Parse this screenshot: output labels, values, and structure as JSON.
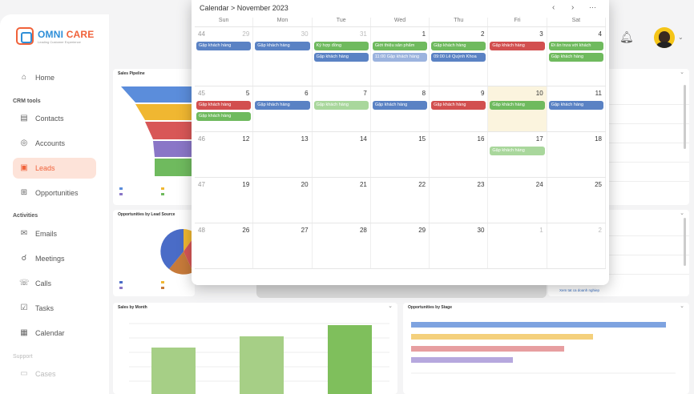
{
  "brand": {
    "name_a": "OMNI",
    "name_b": "CARE",
    "tagline": "Leading Customer Experience"
  },
  "sidebar": {
    "home": "Home",
    "crm_tools_label": "CRM tools",
    "contacts": "Contacts",
    "accounts": "Accounts",
    "leads": "Leads",
    "opportunities": "Opportunities",
    "activities_label": "Activities",
    "emails": "Emails",
    "meetings": "Meetings",
    "calls": "Calls",
    "tasks": "Tasks",
    "calendar": "Calendar",
    "support_label": "Support",
    "cases": "Cases"
  },
  "cards": {
    "sales_pipeline": "Sales Pipeline",
    "opp_by_source": "Opportunities by Lead Source",
    "sales_by_month": "Sales by Month",
    "opp_by_stage": "Opportunities by Stage",
    "view_all_link": "Xem tat ca doanh nghiep"
  },
  "calendar": {
    "breadcrumb": "Calendar > November 2023",
    "days": [
      "Sun",
      "Mon",
      "Tue",
      "Wed",
      "Thu",
      "Fri",
      "Sat"
    ],
    "weeks": [
      {
        "wk": "44",
        "dates": [
          "29",
          "30",
          "31",
          "1",
          "2",
          "3",
          "4"
        ],
        "muted": [
          true,
          true,
          true,
          false,
          false,
          false,
          false
        ],
        "events": [
          {
            "day": 0,
            "row": 0,
            "text": "Gặp khách hàng",
            "color": "blue"
          },
          {
            "day": 1,
            "row": 0,
            "text": "Gặp khách hàng",
            "color": "blue"
          },
          {
            "day": 2,
            "row": 0,
            "text": "Ký hợp đồng",
            "color": "green"
          },
          {
            "day": 2,
            "row": 1,
            "text": "Gặp khách hàng",
            "color": "blue"
          },
          {
            "day": 3,
            "row": 0,
            "text": "Giới thiệu sản phẩm",
            "color": "green"
          },
          {
            "day": 3,
            "row": 1,
            "text": "11:00 Gặp khách hàng",
            "color": "lblue"
          },
          {
            "day": 4,
            "row": 0,
            "text": "Gặp khách hàng",
            "color": "green"
          },
          {
            "day": 4,
            "row": 1,
            "text": "09:00 Lê Quỳnh Khoa",
            "color": "blue"
          },
          {
            "day": 5,
            "row": 0,
            "text": "Gặp khách hàng",
            "color": "red"
          },
          {
            "day": 6,
            "row": 0,
            "text": "Đi ăn trưa với khách",
            "color": "green"
          },
          {
            "day": 6,
            "row": 1,
            "text": "Gặp khách hàng",
            "color": "green"
          }
        ]
      },
      {
        "wk": "45",
        "dates": [
          "5",
          "6",
          "7",
          "8",
          "9",
          "10",
          "11"
        ],
        "muted": [
          false,
          false,
          false,
          false,
          false,
          false,
          false
        ],
        "events": [
          {
            "day": 0,
            "row": 0,
            "text": "Gặp khách hàng",
            "color": "red"
          },
          {
            "day": 0,
            "row": 1,
            "text": "Gặp khách hàng",
            "color": "green"
          },
          {
            "day": 1,
            "row": 0,
            "text": "Gặp khách hàng",
            "color": "blue"
          },
          {
            "day": 2,
            "row": 0,
            "text": "Gặp khách hàng",
            "color": "lgreen"
          },
          {
            "day": 3,
            "row": 0,
            "text": "Gặp khách hàng",
            "color": "blue"
          },
          {
            "day": 4,
            "row": 0,
            "text": "Gặp khách hàng",
            "color": "red"
          },
          {
            "day": 5,
            "row": 0,
            "text": "Gặp khách hàng",
            "color": "green"
          },
          {
            "day": 6,
            "row": 0,
            "text": "Gặp khách hàng",
            "color": "blue"
          }
        ]
      },
      {
        "wk": "46",
        "dates": [
          "12",
          "13",
          "14",
          "15",
          "16",
          "17",
          "18"
        ],
        "muted": [
          false,
          false,
          false,
          false,
          false,
          false,
          false
        ],
        "events": [
          {
            "day": 5,
            "row": 0,
            "text": "Gặp khách hàng",
            "color": "lgreen"
          }
        ]
      },
      {
        "wk": "47",
        "dates": [
          "19",
          "20",
          "21",
          "22",
          "23",
          "24",
          "25"
        ],
        "muted": [
          false,
          false,
          false,
          false,
          false,
          false,
          false
        ],
        "events": []
      },
      {
        "wk": "48",
        "dates": [
          "26",
          "27",
          "28",
          "29",
          "30",
          "1",
          "2"
        ],
        "muted": [
          false,
          false,
          false,
          false,
          false,
          true,
          true
        ],
        "events": []
      }
    ],
    "today_index": {
      "week": 1,
      "day": 5
    }
  },
  "colors": {
    "accent": "#f0623a",
    "brand_blue": "#2f8fd8"
  }
}
